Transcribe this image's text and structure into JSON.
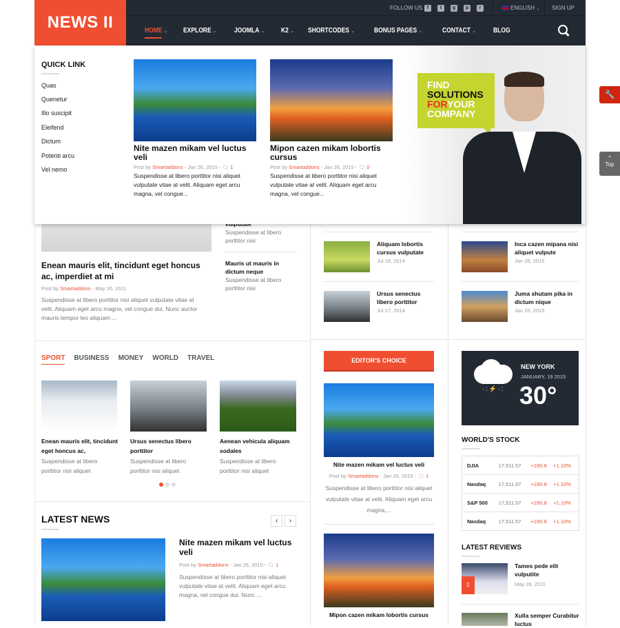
{
  "header": {
    "logo": "NEWS II",
    "follow_us": "FOLLOW US",
    "social_icons": [
      "facebook-icon",
      "twitter-icon",
      "google-plus-icon",
      "pinterest-icon",
      "rss-icon"
    ],
    "language": "ENGLISH",
    "sign_up": "SIGN UP",
    "nav": [
      {
        "label": "HOME",
        "active": true,
        "dropdown": true
      },
      {
        "label": "EXPLORE",
        "dropdown": true
      },
      {
        "label": "JOOMLA",
        "dropdown": true
      },
      {
        "label": "K2",
        "dropdown": true
      },
      {
        "label": "SHORTCODES",
        "dropdown": true
      },
      {
        "label": "BONUS PAGES",
        "dropdown": true
      },
      {
        "label": "CONTACT",
        "dropdown": true
      },
      {
        "label": "BLOG",
        "dropdown": false
      }
    ],
    "colors": {
      "brand": "#f04e30",
      "header_bg": "#232a33"
    }
  },
  "mega_menu": {
    "quick_link_title": "QUICK LINK",
    "quick_links": [
      "Quas",
      "Quenetur",
      "Illo suscipit",
      "Eleifend",
      "Dictum",
      "Potenti arcu",
      "Vel nemo"
    ],
    "posts": [
      {
        "title": "Nite mazen mikam vel luctus veli",
        "post_by": "Post by",
        "author": "Smartaddons",
        "date": "- Jan 26, 2015 -",
        "comments": "1",
        "excerpt": "Suspendisse at libero porttitor nisi aliquet vulputate vitae at velit. Aliquam eget arcu magna, vel congue..."
      },
      {
        "title": "Mipon cazen mikam lobortis cursus",
        "post_by": "Post by",
        "author": "Smartaddons",
        "date": "- Jan 26, 2015 -",
        "comments": "0",
        "excerpt": "Suspendisse at libero porttitor nisi aliquet vulputate vitae at velit. Aliquam eget arcu magna, vel congue..."
      }
    ],
    "ad": {
      "line1": "FIND",
      "line2": "SOLUTIONS",
      "line3a": "FOR",
      "line3b": "YOUR",
      "line4": "COMPANY"
    }
  },
  "side_tools": {
    "top_label": "Top"
  },
  "featured": {
    "main": {
      "title": "Enean mauris elit, tincidunt eget honcus ac, imperdiet at mi",
      "post_by": "Post by",
      "author": "Smartaddons",
      "date": "- May 26, 2011",
      "excerpt": "Suspendisse at libero porttitor nisi aliquet vulputate vitae at velit. Aliquam eget arcu magna, vel congue dui. Nunc auctor mauris tempor leo aliquam ..."
    },
    "side": [
      {
        "title": "vulputate",
        "excerpt": "Suspendisse at libero porttitor nisi"
      },
      {
        "title": "Mauris ut mauris in dictum neque",
        "excerpt": "Suspendisse at libero porttitor nisi"
      }
    ]
  },
  "mid_list": [
    {
      "title": "Aliquam lobortis cursus vulputate",
      "date": "Jul 16, 2014"
    },
    {
      "title": "Ursus senectus libero porttitor",
      "date": "Jul 17, 2014"
    }
  ],
  "right_list": [
    {
      "title": "Inca cazen mipana nisi aliquet vulpute",
      "date": "Jan 26, 2015"
    },
    {
      "title": "Juma xhutam pika in dictum nique",
      "date": "Jan 26, 2015"
    }
  ],
  "category_tabs": {
    "tabs": [
      "SPORT",
      "BUSINESS",
      "MONEY",
      "WORLD",
      "TRAVEL"
    ],
    "active": 0,
    "items": [
      {
        "title": "Enean mauris elit, tincidunt eget honcus ac,",
        "excerpt": "Suspendisse at libero porttitor nisi aliquet"
      },
      {
        "title": "Ursus senectus libero porttitor",
        "excerpt": "Suspendisse at libero porttitor nisi aliquet"
      },
      {
        "title": "Aenean vehicula aliquam sodales",
        "excerpt": "Suspendisse at libero porttitor nisi aliquet"
      }
    ],
    "pager": {
      "pages": 3,
      "current": 1
    }
  },
  "latest_news": {
    "title": "LATEST NEWS",
    "post": {
      "title": "Nite mazen mikam vel luctus veli",
      "post_by": "Post by",
      "author": "Smartaddons",
      "date": "- Jan 26, 2015 -",
      "comments": "1",
      "excerpt": "Suspendisse at libero porttitor nisi aliquet vulputate vitae at velit. Aliquam eget arcu magna, vel congue dui. Nunc ..."
    }
  },
  "editors_choice": {
    "title": "EDITOR'S CHOICE",
    "posts": [
      {
        "title": "Nite mazen mikam vel luctus veli",
        "post_by": "Post by",
        "author": "Smartaddons",
        "date": "- Jan 26, 2015 -",
        "comments": "1",
        "excerpt": "Suspendisse at libero porttitor nisi aliquet vulputate vitae at velit. Aliquam eget arcu magna,..."
      },
      {
        "title": "Mipon cazen mikam lobortis cursus"
      }
    ]
  },
  "weather": {
    "city": "NEW YORK",
    "date": "JANUARY, 19 2015",
    "temp": "30°",
    "icon": "thunder-snow-cloud-icon"
  },
  "stock": {
    "title": "WORLD'S STOCK",
    "rows": [
      {
        "name": "DJIA",
        "value": "17,511.57",
        "change": "+190.8",
        "pct": "+1.10%"
      },
      {
        "name": "Nasdaq",
        "value": "17,511.57",
        "change": "+190.8",
        "pct": "+1.10%"
      },
      {
        "name": "S&P 500",
        "value": "17,511.57",
        "change": "+190.8",
        "pct": "+1.10%"
      },
      {
        "name": "Nasdaq",
        "value": "17,511.57",
        "change": "+190.8",
        "pct": "+1.10%"
      }
    ]
  },
  "latest_reviews": {
    "title": "LATEST REVIEWS",
    "items": [
      {
        "title": "Tames pede elit vulputite",
        "date": "May 26, 2011",
        "score": "2"
      },
      {
        "title": "Xulla semper Curabitur luctus"
      }
    ]
  }
}
